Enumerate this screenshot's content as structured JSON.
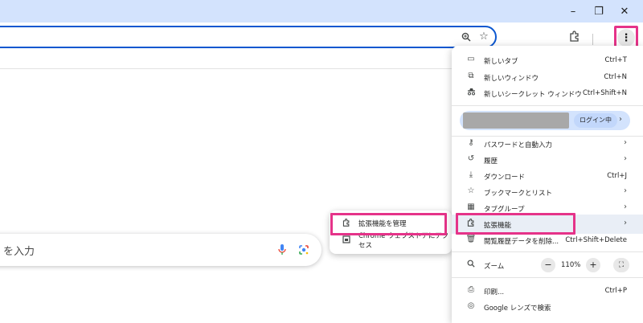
{
  "window": {
    "minimize": "–",
    "restore": "❐",
    "close": "✕"
  },
  "ntp": {
    "search_placeholder": "を入力"
  },
  "submenu": {
    "items": [
      {
        "icon": "puzzle-icon",
        "label": "拡張機能を管理"
      },
      {
        "icon": "store-icon",
        "label": "Chrome ウェブストアにアクセス"
      }
    ]
  },
  "menu": {
    "new_tab": {
      "label": "新しいタブ",
      "shortcut": "Ctrl+T"
    },
    "new_window": {
      "label": "新しいウィンドウ",
      "shortcut": "Ctrl+N"
    },
    "incognito": {
      "label": "新しいシークレット ウィンドウ",
      "shortcut": "Ctrl+Shift+N"
    },
    "profile": {
      "status": "ログイン中"
    },
    "passwords": {
      "label": "パスワードと自動入力"
    },
    "history": {
      "label": "履歴"
    },
    "downloads": {
      "label": "ダウンロード",
      "shortcut": "Ctrl+J"
    },
    "bookmarks": {
      "label": "ブックマークとリスト"
    },
    "tab_groups": {
      "label": "タブグループ"
    },
    "extensions": {
      "label": "拡張機能"
    },
    "clear_data": {
      "label": "閲覧履歴データを削除...",
      "shortcut": "Ctrl+Shift+Delete"
    },
    "zoom": {
      "label": "ズーム",
      "minus": "−",
      "value": "110%",
      "plus": "+"
    },
    "print": {
      "label": "印刷...",
      "shortcut": "Ctrl+P"
    },
    "lens": {
      "label": "Google レンズで検索"
    }
  },
  "colors": {
    "highlight": "#e53389",
    "titlebar": "#d3e3fd",
    "omnibox_border": "#0b57d0"
  }
}
